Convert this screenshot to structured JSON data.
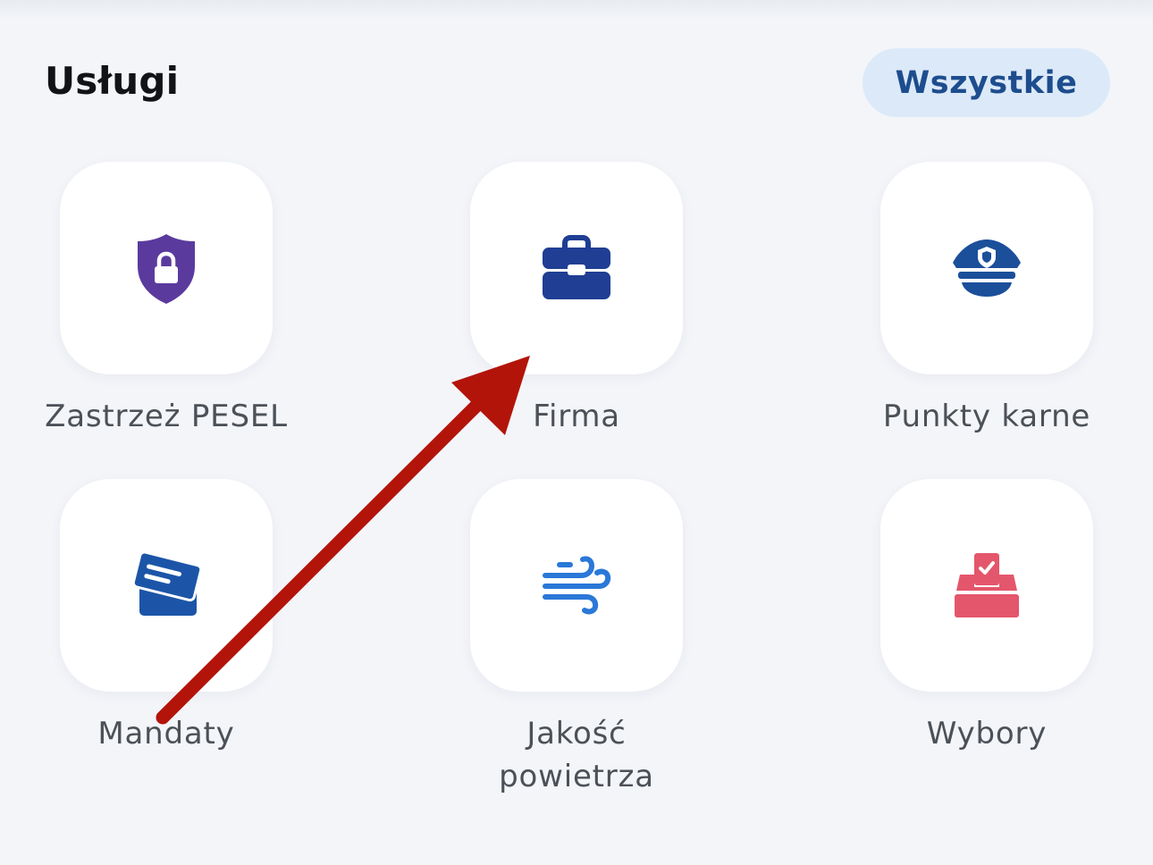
{
  "header": {
    "title": "Usługi",
    "all_button_label": "Wszystkie"
  },
  "services": [
    {
      "label": "Zastrzeż PESEL",
      "icon": "shield-lock-icon",
      "color": "#5b3a9e"
    },
    {
      "label": "Firma",
      "icon": "briefcase-icon",
      "color": "#1f3e94"
    },
    {
      "label": "Punkty karne",
      "icon": "police-cap-icon",
      "color": "#1b4f9a"
    },
    {
      "label": "Mandaty",
      "icon": "cards-icon",
      "color": "#1c55a8"
    },
    {
      "label_line1": "Jakość",
      "label_line2": "powietrza",
      "icon": "wind-icon",
      "color": "#2a78d8"
    },
    {
      "label": "Wybory",
      "icon": "ballot-box-icon",
      "color": "#e4566b"
    }
  ],
  "annotation": {
    "icon": "red-arrow-icon",
    "color": "#b3140a"
  }
}
